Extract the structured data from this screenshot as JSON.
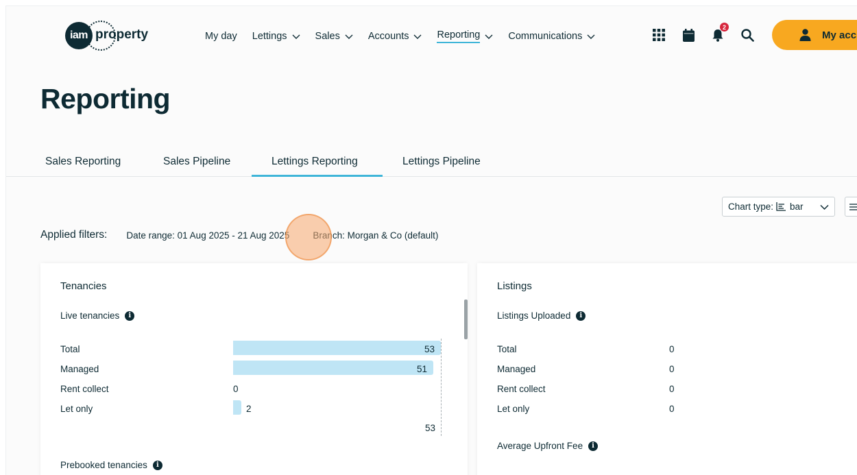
{
  "logo": {
    "mark": "iam",
    "word": "property"
  },
  "nav": [
    {
      "label": "My day",
      "dropdown": false,
      "active": false
    },
    {
      "label": "Lettings",
      "dropdown": true,
      "active": false
    },
    {
      "label": "Sales",
      "dropdown": true,
      "active": false
    },
    {
      "label": "Accounts",
      "dropdown": true,
      "active": false
    },
    {
      "label": "Reporting",
      "dropdown": true,
      "active": true
    },
    {
      "label": "Communications",
      "dropdown": true,
      "active": false
    }
  ],
  "header_icons": {
    "apps": "grid-icon",
    "calendar": "calendar-icon",
    "notifications": "bell-icon",
    "notification_count": "2",
    "search": "search-icon"
  },
  "account": {
    "label": "My acc",
    "icon": "user-icon"
  },
  "page": {
    "title": "Reporting"
  },
  "tabs": [
    {
      "label": "Sales Reporting",
      "active": false
    },
    {
      "label": "Sales Pipeline",
      "active": false
    },
    {
      "label": "Lettings Reporting",
      "active": true
    },
    {
      "label": "Lettings Pipeline",
      "active": false
    }
  ],
  "toolbar": {
    "chart_type_label": "Chart type:",
    "chart_type_value": "bar"
  },
  "filters": {
    "label": "Applied filters:",
    "date_range": "Date range: 01 Aug 2025 - 21 Aug 2025",
    "branch": "Branch: Morgan & Co (default)"
  },
  "tenancies": {
    "title": "Tenancies",
    "live_title": "Live tenancies",
    "rows": [
      {
        "label": "Total",
        "value": 53
      },
      {
        "label": "Managed",
        "value": 51
      },
      {
        "label": "Rent collect",
        "value": 0
      },
      {
        "label": "Let only",
        "value": 2
      }
    ],
    "axis_max": 53,
    "axis_label": "53",
    "prebooked_title": "Prebooked tenancies"
  },
  "listings": {
    "title": "Listings",
    "uploaded_title": "Listings Uploaded",
    "rows": [
      {
        "label": "Total",
        "value": "0"
      },
      {
        "label": "Managed",
        "value": "0"
      },
      {
        "label": "Rent collect",
        "value": "0"
      },
      {
        "label": "Let only",
        "value": "0"
      }
    ],
    "fee_title": "Average Upfront Fee"
  },
  "colors": {
    "accent": "#3fb5d8",
    "bar": "#bfe5f5",
    "account": "#f8a820",
    "text": "#0d2a33"
  }
}
